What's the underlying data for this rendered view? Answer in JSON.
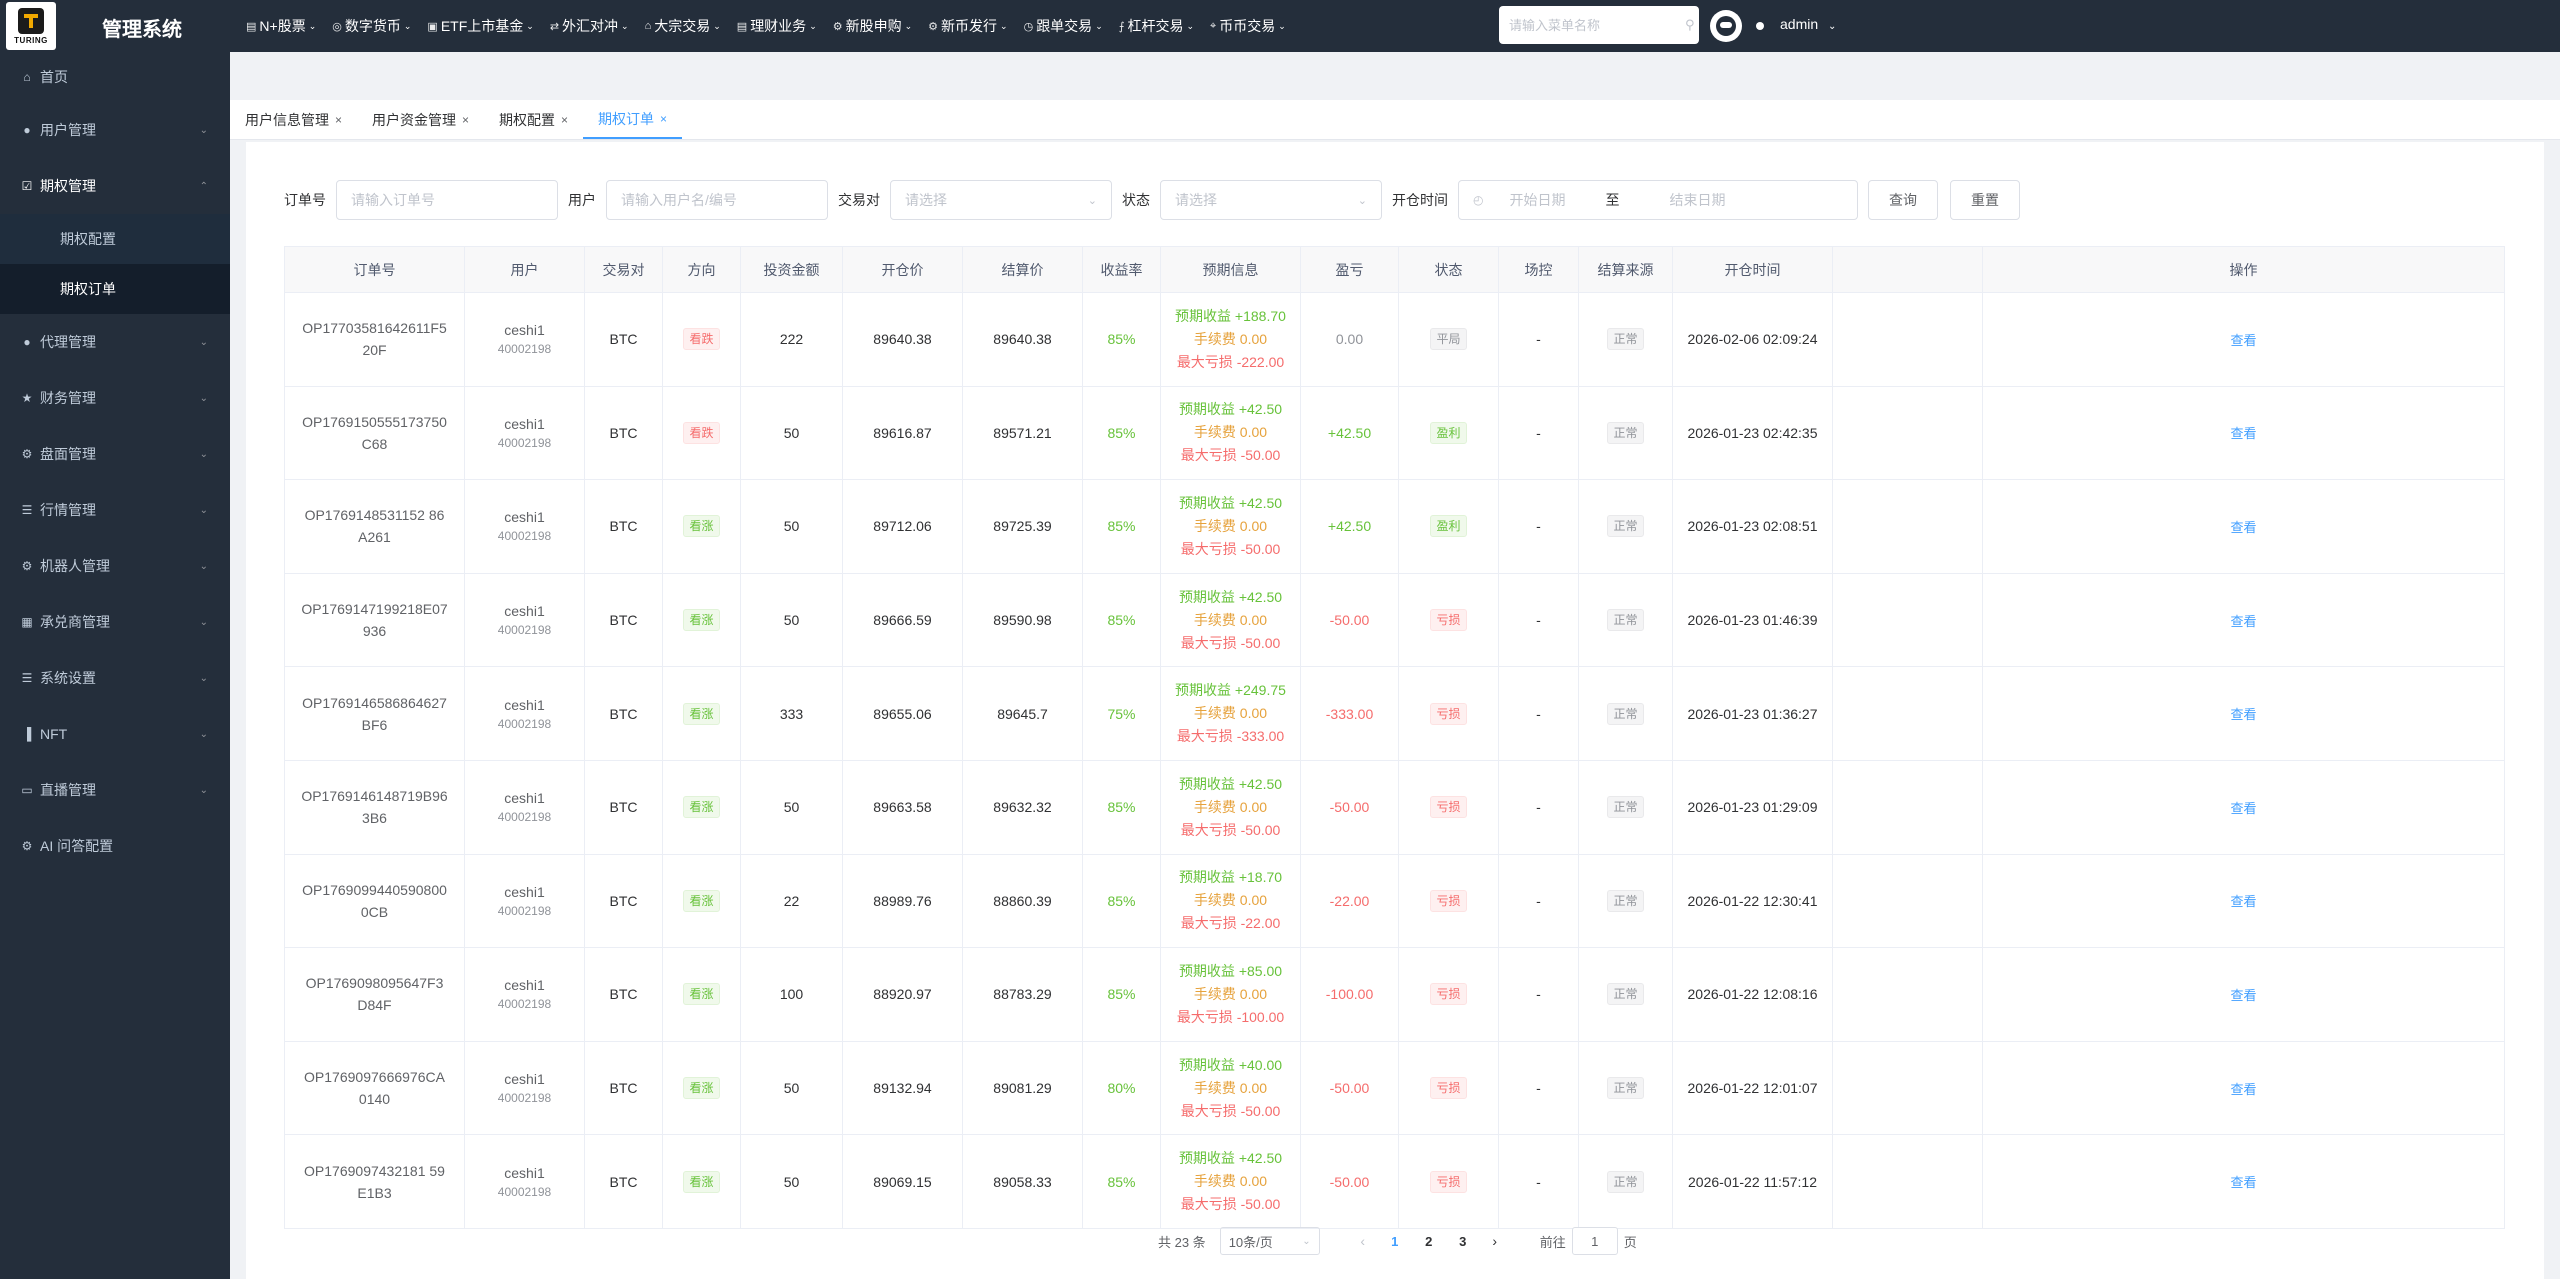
{
  "logo": {
    "text": "TURING"
  },
  "app_title": "管理系统",
  "topnav": [
    {
      "label": "N+股票",
      "icon": "chart-icon"
    },
    {
      "label": "数字货币",
      "icon": "coin-icon"
    },
    {
      "label": "ETF上市基金",
      "icon": "fund-icon"
    },
    {
      "label": "外汇对冲",
      "icon": "exchange-icon"
    },
    {
      "label": "大宗交易",
      "icon": "bank-icon"
    },
    {
      "label": "理财业务",
      "icon": "wallet-icon"
    },
    {
      "label": "新股申购",
      "icon": "gear-icon"
    },
    {
      "label": "新币发行",
      "icon": "gear-icon"
    },
    {
      "label": "跟单交易",
      "icon": "clock-icon"
    },
    {
      "label": "杠杆交易",
      "icon": "lever-icon"
    },
    {
      "label": "币币交易",
      "icon": "pin-icon"
    }
  ],
  "menu_search": {
    "placeholder": "请输入菜单名称"
  },
  "user": {
    "name": "admin"
  },
  "sidebar": {
    "items": [
      {
        "label": "首页",
        "icon": "home-icon",
        "expandable": false
      },
      {
        "label": "用户管理",
        "icon": "user-icon",
        "expandable": true
      },
      {
        "label": "期权管理",
        "icon": "checkbox-icon",
        "expandable": true,
        "open": true,
        "children": [
          {
            "label": "期权配置"
          },
          {
            "label": "期权订单",
            "active": true
          }
        ]
      },
      {
        "label": "代理管理",
        "icon": "user-icon",
        "expandable": true
      },
      {
        "label": "财务管理",
        "icon": "star-icon",
        "expandable": true
      },
      {
        "label": "盘面管理",
        "icon": "gear-icon",
        "expandable": true
      },
      {
        "label": "行情管理",
        "icon": "list-icon",
        "expandable": true
      },
      {
        "label": "机器人管理",
        "icon": "gear-icon",
        "expandable": true
      },
      {
        "label": "承兑商管理",
        "icon": "grid-icon",
        "expandable": true
      },
      {
        "label": "系统设置",
        "icon": "list-icon",
        "expandable": true
      },
      {
        "label": "NFT",
        "icon": "bar-icon",
        "expandable": true
      },
      {
        "label": "直播管理",
        "icon": "video-icon",
        "expandable": true
      },
      {
        "label": "AI 问答配置",
        "icon": "gear-icon",
        "expandable": false
      }
    ]
  },
  "tabs": [
    {
      "label": "用户信息管理",
      "active": false
    },
    {
      "label": "用户资金管理",
      "active": false
    },
    {
      "label": "期权配置",
      "active": false
    },
    {
      "label": "期权订单",
      "active": true
    }
  ],
  "filters": {
    "order_no_label": "订单号",
    "order_no_placeholder": "请输入订单号",
    "user_label": "用户",
    "user_placeholder": "请输入用户名/编号",
    "pair_label": "交易对",
    "pair_placeholder": "请选择",
    "status_label": "状态",
    "status_placeholder": "请选择",
    "open_time_label": "开仓时间",
    "start_placeholder": "开始日期",
    "date_sep": "至",
    "end_placeholder": "结束日期",
    "query_button": "查询",
    "reset_button": "重置"
  },
  "table": {
    "headers": [
      "订单号",
      "用户",
      "交易对",
      "方向",
      "投资金额",
      "开仓价",
      "结算价",
      "收益率",
      "预期信息",
      "盈亏",
      "状态",
      "场控",
      "结算来源",
      "开仓时间",
      "",
      "操作"
    ],
    "expected_labels": {
      "profit": "预期收益",
      "fee": "手续费",
      "max_loss": "最大亏损"
    },
    "action_label": "查看",
    "rows": [
      {
        "order_no": "OP1770358164261 1F520F",
        "order_no_raw": "OP17703581642611F520F",
        "user": "ceshi1",
        "user_id": "40002198",
        "pair": "BTC",
        "direction": "看跌",
        "dir_type": "down",
        "amount": "222",
        "open_price": "89640.38",
        "settle_price": "89640.38",
        "rate": "85%",
        "exp_profit": "+188.70",
        "fee": "0.00",
        "max_loss": "-222.00",
        "pnl": "0.00",
        "pnl_type": "muted",
        "status": "平局",
        "status_type": "gray",
        "control": "-",
        "source": "正常",
        "open_time": "2026-02-06 02:09:24"
      },
      {
        "order_no_raw": "OP1769150555173750C68",
        "user": "ceshi1",
        "user_id": "40002198",
        "pair": "BTC",
        "direction": "看跌",
        "dir_type": "down",
        "amount": "50",
        "open_price": "89616.87",
        "settle_price": "89571.21",
        "rate": "85%",
        "exp_profit": "+42.50",
        "fee": "0.00",
        "max_loss": "-50.00",
        "pnl": "+42.50",
        "pnl_type": "green",
        "status": "盈利",
        "status_type": "win",
        "control": "-",
        "source": "正常",
        "open_time": "2026-01-23 02:42:35"
      },
      {
        "order_no_raw": "OP1769148531152 86A261",
        "user": "ceshi1",
        "user_id": "40002198",
        "pair": "BTC",
        "direction": "看涨",
        "dir_type": "up",
        "amount": "50",
        "open_price": "89712.06",
        "settle_price": "89725.39",
        "rate": "85%",
        "exp_profit": "+42.50",
        "fee": "0.00",
        "max_loss": "-50.00",
        "pnl": "+42.50",
        "pnl_type": "green",
        "status": "盈利",
        "status_type": "win",
        "control": "-",
        "source": "正常",
        "open_time": "2026-01-23 02:08:51"
      },
      {
        "order_no_raw": "OP1769147199218E07936",
        "user": "ceshi1",
        "user_id": "40002198",
        "pair": "BTC",
        "direction": "看涨",
        "dir_type": "up",
        "amount": "50",
        "open_price": "89666.59",
        "settle_price": "89590.98",
        "rate": "85%",
        "exp_profit": "+42.50",
        "fee": "0.00",
        "max_loss": "-50.00",
        "pnl": "-50.00",
        "pnl_type": "red",
        "status": "亏损",
        "status_type": "loss",
        "control": "-",
        "source": "正常",
        "open_time": "2026-01-23 01:46:39"
      },
      {
        "order_no_raw": "OP1769146586864627BF6",
        "user": "ceshi1",
        "user_id": "40002198",
        "pair": "BTC",
        "direction": "看涨",
        "dir_type": "up",
        "amount": "333",
        "open_price": "89655.06",
        "settle_price": "89645.7",
        "rate": "75%",
        "exp_profit": "+249.75",
        "fee": "0.00",
        "max_loss": "-333.00",
        "pnl": "-333.00",
        "pnl_type": "red",
        "status": "亏损",
        "status_type": "loss",
        "control": "-",
        "source": "正常",
        "open_time": "2026-01-23 01:36:27"
      },
      {
        "order_no_raw": "OP1769146148719B963B6",
        "user": "ceshi1",
        "user_id": "40002198",
        "pair": "BTC",
        "direction": "看涨",
        "dir_type": "up",
        "amount": "50",
        "open_price": "89663.58",
        "settle_price": "89632.32",
        "rate": "85%",
        "exp_profit": "+42.50",
        "fee": "0.00",
        "max_loss": "-50.00",
        "pnl": "-50.00",
        "pnl_type": "red",
        "status": "亏损",
        "status_type": "loss",
        "control": "-",
        "source": "正常",
        "open_time": "2026-01-23 01:29:09"
      },
      {
        "order_no_raw": "OP1769099440590800 0CB",
        "user": "ceshi1",
        "user_id": "40002198",
        "pair": "BTC",
        "direction": "看涨",
        "dir_type": "up",
        "amount": "22",
        "open_price": "88989.76",
        "settle_price": "88860.39",
        "rate": "85%",
        "exp_profit": "+18.70",
        "fee": "0.00",
        "max_loss": "-22.00",
        "pnl": "-22.00",
        "pnl_type": "red",
        "status": "亏损",
        "status_type": "loss",
        "control": "-",
        "source": "正常",
        "open_time": "2026-01-22 12:30:41"
      },
      {
        "order_no_raw": "OP1769098095647F3D84F",
        "user": "ceshi1",
        "user_id": "40002198",
        "pair": "BTC",
        "direction": "看涨",
        "dir_type": "up",
        "amount": "100",
        "open_price": "88920.97",
        "settle_price": "88783.29",
        "rate": "85%",
        "exp_profit": "+85.00",
        "fee": "0.00",
        "max_loss": "-100.00",
        "pnl": "-100.00",
        "pnl_type": "red",
        "status": "亏损",
        "status_type": "loss",
        "control": "-",
        "source": "正常",
        "open_time": "2026-01-22 12:08:16"
      },
      {
        "order_no_raw": "OP1769097666976CA0140",
        "user": "ceshi1",
        "user_id": "40002198",
        "pair": "BTC",
        "direction": "看涨",
        "dir_type": "up",
        "amount": "50",
        "open_price": "89132.94",
        "settle_price": "89081.29",
        "rate": "80%",
        "exp_profit": "+40.00",
        "fee": "0.00",
        "max_loss": "-50.00",
        "pnl": "-50.00",
        "pnl_type": "red",
        "status": "亏损",
        "status_type": "loss",
        "control": "-",
        "source": "正常",
        "open_time": "2026-01-22 12:01:07"
      },
      {
        "order_no_raw": "OP1769097432181 59E1B3",
        "user": "ceshi1",
        "user_id": "40002198",
        "pair": "BTC",
        "direction": "看涨",
        "dir_type": "up",
        "amount": "50",
        "open_price": "89069.15",
        "settle_price": "89058.33",
        "rate": "85%",
        "exp_profit": "+42.50",
        "fee": "0.00",
        "max_loss": "-50.00",
        "pnl": "-50.00",
        "pnl_type": "red",
        "status": "亏损",
        "status_type": "loss",
        "control": "-",
        "source": "正常",
        "open_time": "2026-01-22 11:57:12"
      }
    ]
  },
  "pagination": {
    "total_text": "共 23 条",
    "page_size": "10条/页",
    "pages": [
      "1",
      "2",
      "3"
    ],
    "current": "1",
    "goto_label": "前往",
    "goto_value": "1",
    "page_unit": "页"
  },
  "colors": {
    "accent": "#409eff",
    "sidebar_bg": "#242e3b",
    "profit": "#67c23a",
    "loss": "#f56c6c",
    "fee": "#e6a23c"
  }
}
